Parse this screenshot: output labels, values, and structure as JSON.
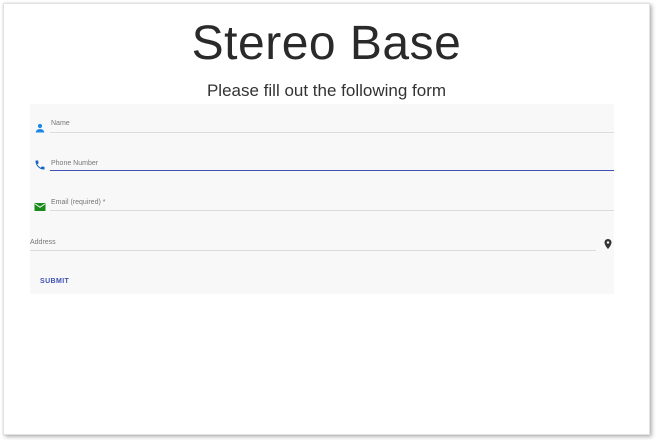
{
  "page": {
    "title": "Stereo Base",
    "subtitle": "Please fill out the following form"
  },
  "form": {
    "fields": [
      {
        "name": "name",
        "label": "Name",
        "icon": "person-icon",
        "icon_color": "#1e88e5",
        "active": false
      },
      {
        "name": "phone",
        "label": "Phone Number",
        "icon": "phone-icon",
        "icon_color": "#1565c0",
        "active": true
      },
      {
        "name": "email",
        "label": "Email (required) *",
        "icon": "email-icon",
        "icon_color": "#1b8a1b",
        "active": false
      },
      {
        "name": "address",
        "label": "Address",
        "icon": "location-pin-icon",
        "icon_color": "#333333",
        "active": false
      }
    ],
    "submit_label": "SUBMIT"
  },
  "colors": {
    "accent": "#3f51b5",
    "panel_bg": "#f8f8f8"
  }
}
